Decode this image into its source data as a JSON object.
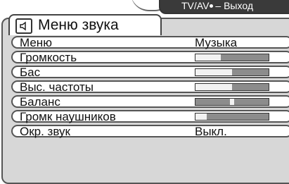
{
  "hint": {
    "label": "TV/AV",
    "text": "– Выход"
  },
  "title": "Меню звука",
  "rows": [
    {
      "label": "Меню",
      "value": "Музыка"
    },
    {
      "label": "Громкость",
      "level": 0.35
    },
    {
      "label": "Бас",
      "level": 0.5
    },
    {
      "label": "Выс. частоты",
      "level": 0.5
    },
    {
      "label": "Баланс",
      "level": 0.5
    },
    {
      "label": "Громк наушников",
      "level": 0.15
    },
    {
      "label": "Окр. звук",
      "value": "Выкл."
    }
  ],
  "colors": {
    "panel": "#d7d7d7",
    "row": "#ffffff",
    "bar_empty": "#8c8c8c",
    "bar_fill": "#f2f2f2"
  }
}
